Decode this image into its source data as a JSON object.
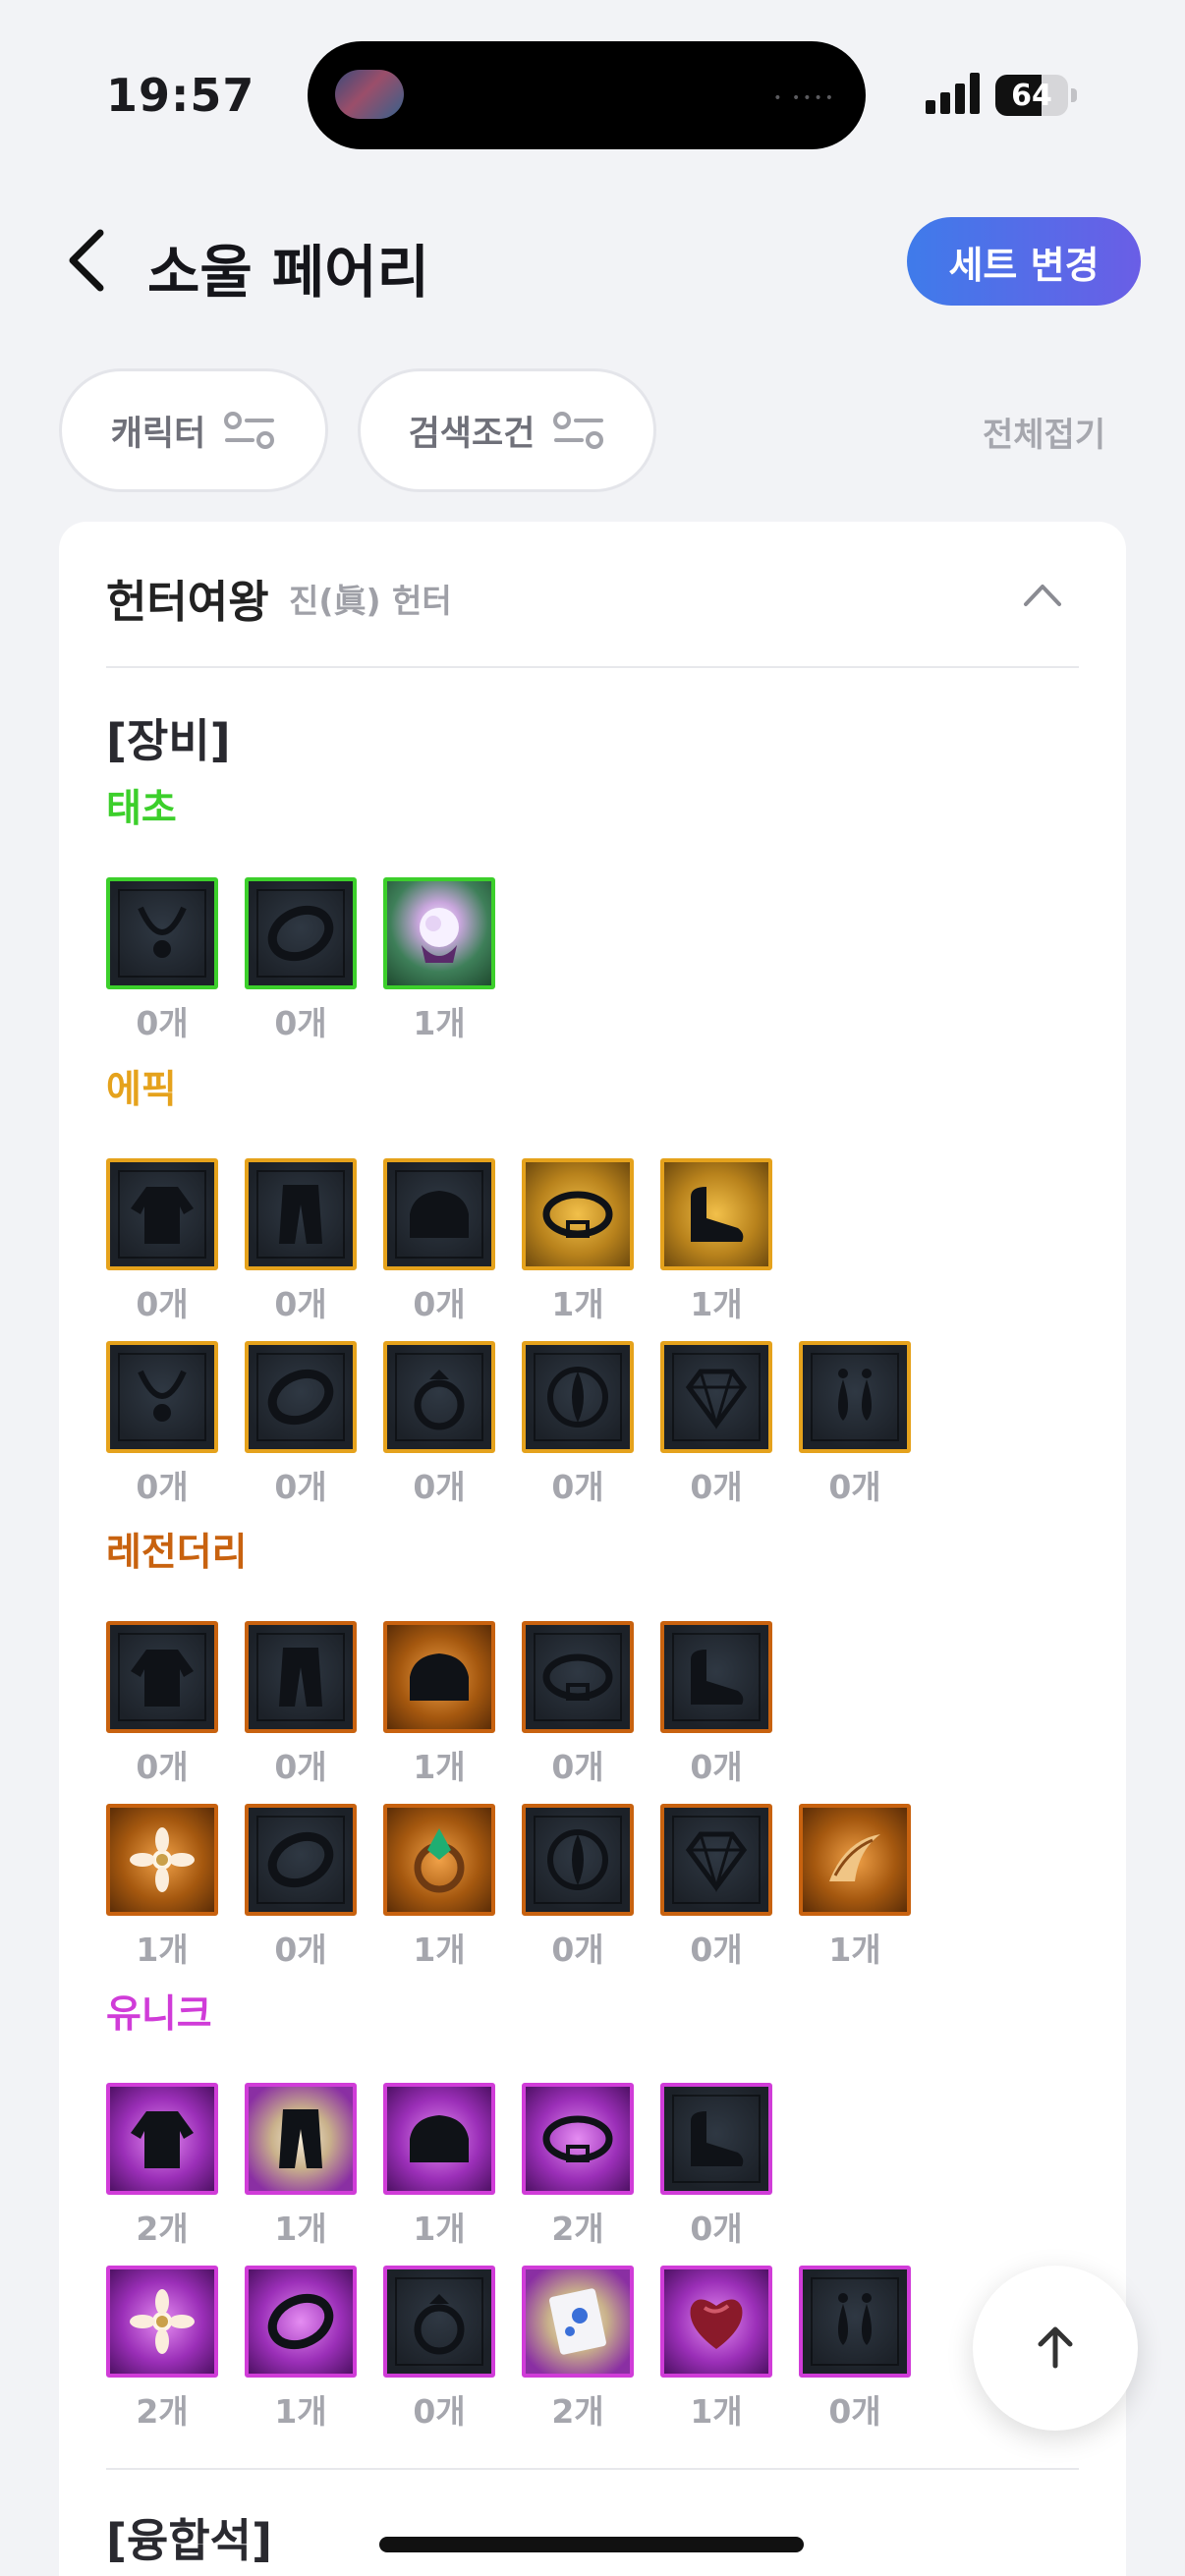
{
  "status_bar": {
    "time": "19:57",
    "battery": "64",
    "battery_level": 0.64,
    "signal_bars": 4
  },
  "header": {
    "title": "소울 페어리",
    "set_button": "세트 변경",
    "back_icon": "chevron-left-icon"
  },
  "filters": {
    "character_chip": "캐릭터",
    "search_chip": "검색조건",
    "collapse_all": "전체접기",
    "filter_icon": "sliders-icon"
  },
  "character": {
    "name": "헌터여왕",
    "class": "진(眞) 헌터",
    "toggle_icon": "chevron-up-icon"
  },
  "equipment_title": "[장비]",
  "fusion_title": "[융합석]",
  "colors": {
    "taecho": "#3ccf2b",
    "epic": "#e5a21c",
    "legendary": "#c8620f",
    "unique": "#d03cd8",
    "accent": "#4a76ea"
  },
  "tiers": [
    {
      "name": "태초",
      "color": "#3ccf2b",
      "rows": [
        [
          {
            "icon": "necklace-icon",
            "count": "0개",
            "owned": false
          },
          {
            "icon": "bracelet-icon",
            "count": "0개",
            "owned": false
          },
          {
            "icon": "fairy-orb-icon",
            "count": "1개",
            "owned": true
          }
        ]
      ]
    },
    {
      "name": "에픽",
      "color": "#e5a21c",
      "rows": [
        [
          {
            "icon": "top-armor-icon",
            "count": "0개",
            "owned": false
          },
          {
            "icon": "pants-icon",
            "count": "0개",
            "owned": false
          },
          {
            "icon": "shoulder-icon",
            "count": "0개",
            "owned": false
          },
          {
            "icon": "belt-icon",
            "count": "1개",
            "owned": true
          },
          {
            "icon": "shoes-icon",
            "count": "1개",
            "owned": true
          }
        ],
        [
          {
            "icon": "necklace-icon",
            "count": "0개",
            "owned": false
          },
          {
            "icon": "bracelet-icon",
            "count": "0개",
            "owned": false
          },
          {
            "icon": "ring-icon",
            "count": "0개",
            "owned": false
          },
          {
            "icon": "support-icon",
            "count": "0개",
            "owned": false
          },
          {
            "icon": "magic-stone-icon",
            "count": "0개",
            "owned": false
          },
          {
            "icon": "earring-icon",
            "count": "0개",
            "owned": false
          }
        ]
      ]
    },
    {
      "name": "레전더리",
      "color": "#c8620f",
      "rows": [
        [
          {
            "icon": "top-armor-icon",
            "count": "0개",
            "owned": false
          },
          {
            "icon": "pants-icon",
            "count": "0개",
            "owned": false
          },
          {
            "icon": "shoulder-icon",
            "count": "1개",
            "owned": true
          },
          {
            "icon": "belt-icon",
            "count": "0개",
            "owned": false
          },
          {
            "icon": "shoes-icon",
            "count": "0개",
            "owned": false
          }
        ],
        [
          {
            "icon": "flower-necklace-icon",
            "count": "1개",
            "owned": true
          },
          {
            "icon": "bracelet-icon",
            "count": "0개",
            "owned": false
          },
          {
            "icon": "gem-ring-icon",
            "count": "1개",
            "owned": true
          },
          {
            "icon": "support-icon",
            "count": "0개",
            "owned": false
          },
          {
            "icon": "magic-stone-icon",
            "count": "0개",
            "owned": false
          },
          {
            "icon": "horn-earring-icon",
            "count": "1개",
            "owned": true
          }
        ]
      ]
    },
    {
      "name": "유니크",
      "color": "#d03cd8",
      "rows": [
        [
          {
            "icon": "top-armor-icon",
            "count": "2개",
            "owned": true
          },
          {
            "icon": "pants-icon",
            "count": "1개",
            "owned": true
          },
          {
            "icon": "shoulder-icon",
            "count": "1개",
            "owned": true
          },
          {
            "icon": "belt-icon",
            "count": "2개",
            "owned": true
          },
          {
            "icon": "shoes-icon",
            "count": "0개",
            "owned": false
          }
        ],
        [
          {
            "icon": "flower-necklace-icon",
            "count": "2개",
            "owned": true
          },
          {
            "icon": "bracelet-icon",
            "count": "1개",
            "owned": true
          },
          {
            "icon": "ring-icon",
            "count": "0개",
            "owned": false
          },
          {
            "icon": "card-icon",
            "count": "2개",
            "owned": true
          },
          {
            "icon": "heart-icon",
            "count": "1개",
            "owned": true
          },
          {
            "icon": "earring-icon",
            "count": "0개",
            "owned": false
          }
        ]
      ]
    }
  ],
  "scroll_top_icon": "arrow-up-icon"
}
